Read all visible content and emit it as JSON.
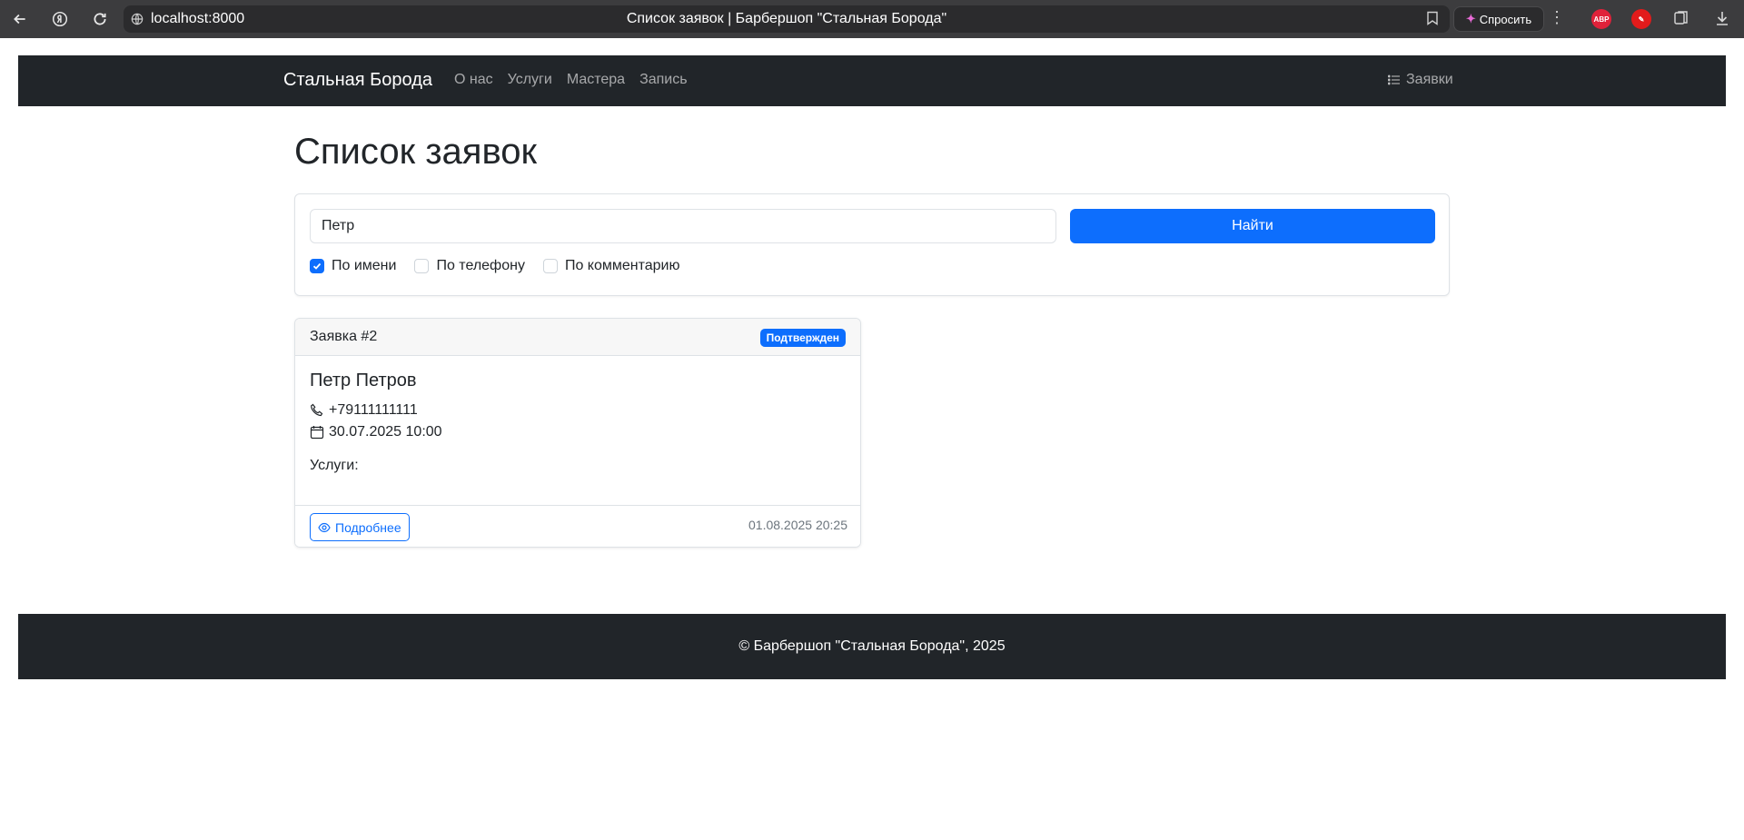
{
  "browser": {
    "url": "localhost:8000",
    "tab_title": "Список заявок | Барбершоп \"Стальная Борода\"",
    "ask_label": "Спросить",
    "ext_abp_label": "ABP"
  },
  "navbar": {
    "brand": "Стальная Борода",
    "links": [
      "О нас",
      "Услуги",
      "Мастера",
      "Запись"
    ],
    "right_link": "Заявки"
  },
  "main": {
    "title": "Список заявок",
    "search": {
      "value": "Петр",
      "button_label": "Найти",
      "filters": [
        {
          "label": "По имени",
          "checked": true
        },
        {
          "label": "По телефону",
          "checked": false
        },
        {
          "label": "По комментарию",
          "checked": false
        }
      ]
    },
    "request": {
      "number": "Заявка #2",
      "status": "Подтвержден",
      "client_name": "Петр Петров",
      "phone": "+79111111111",
      "datetime": "30.07.2025 10:00",
      "services_label": "Услуги:",
      "details_label": "Подробнее",
      "created_at": "01.08.2025 20:25"
    }
  },
  "footer": {
    "text": "© Барбершоп \"Стальная Борода\", 2025"
  },
  "colors": {
    "primary": "#0d6efd",
    "navbar_bg": "#212529",
    "chrome_bg": "#3c3c3e"
  }
}
